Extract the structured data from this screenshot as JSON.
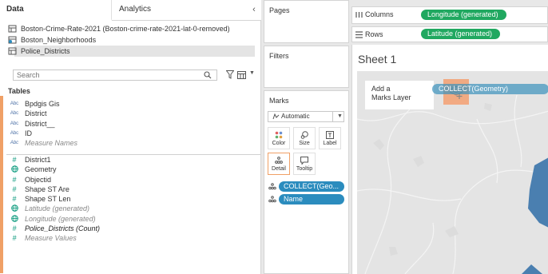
{
  "data_pane": {
    "tabs": {
      "data": "Data",
      "analytics": "Analytics"
    },
    "collapse_glyph": "‹",
    "datasources": [
      {
        "label": "Boston-Crime-Rate-2021 (Boston-crime-rate-2021-lat-0-removed)",
        "icon": "datasource-icon"
      },
      {
        "label": "Boston_Neighborhoods",
        "icon": "datasource-linked-icon"
      },
      {
        "label": "Police_Districts",
        "icon": "datasource-icon",
        "selected": true
      }
    ],
    "search_placeholder": "Search",
    "tables_heading": "Tables",
    "dimensions": [
      {
        "type": "Abc",
        "label": "Bpdgis Gis"
      },
      {
        "type": "Abc",
        "label": "District"
      },
      {
        "type": "Abc",
        "label": "District__"
      },
      {
        "type": "Abc",
        "label": "ID"
      },
      {
        "type": "Abc",
        "label": "Measure Names",
        "style": "italic"
      }
    ],
    "measures": [
      {
        "type": "#",
        "label": "District1"
      },
      {
        "type": "globe",
        "label": "Geometry"
      },
      {
        "type": "#",
        "label": "Objectid"
      },
      {
        "type": "#",
        "label": "Shape ST Are"
      },
      {
        "type": "#",
        "label": "Shape ST Len"
      },
      {
        "type": "globe",
        "label": "Latitude (generated)",
        "style": "italic"
      },
      {
        "type": "globe",
        "label": "Longitude (generated)",
        "style": "italic"
      },
      {
        "type": "#",
        "label": "Police_Districts (Count)",
        "style": "italic-dark"
      },
      {
        "type": "#",
        "label": "Measure Values",
        "style": "italic"
      }
    ]
  },
  "pages_card": {
    "title": "Pages"
  },
  "filters_card": {
    "title": "Filters"
  },
  "marks_card": {
    "title": "Marks",
    "mark_type": "Automatic",
    "buttons": {
      "color": "Color",
      "size": "Size",
      "label": "Label",
      "detail": "Detail",
      "tooltip": "Tooltip"
    },
    "pills": [
      "COLLECT(Geo...",
      "Name"
    ]
  },
  "columns_shelf": {
    "label": "Columns",
    "pill": "Longitude (generated)"
  },
  "rows_shelf": {
    "label": "Rows",
    "pill": "Latitude (generated)"
  },
  "sheet": {
    "title": "Sheet 1",
    "add_layer_line1": "Add a",
    "add_layer_line2": "Marks Layer",
    "drag_pill": "COLLECT(Geometry)"
  },
  "colors": {
    "accent_orange": "#f0a066",
    "pill_blue": "#2b8cbe",
    "pill_green": "#20a860",
    "district_blue": "#4a7fb0"
  }
}
